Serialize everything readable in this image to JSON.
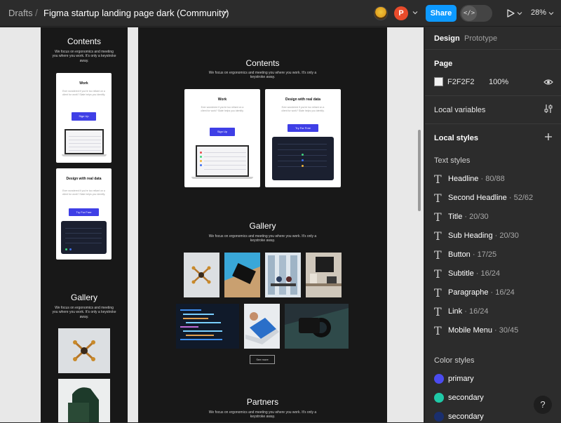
{
  "topbar": {
    "breadcrumb_root": "Drafts",
    "separator": "/",
    "file_title": "Figma startup landing page dark (Community)",
    "avatar_letter": "P",
    "share_label": "Share",
    "dev_mode_glyph": "</>",
    "zoom": "28%"
  },
  "canvas": {
    "small_frame": {
      "contents_title": "Contents",
      "contents_sub": "We focus on ergonomics and meeting you where you work. It's only a keystroke away.",
      "card1": {
        "title": "Work",
        "body": "Ever wondered if you're too reliant on a client for work? Slate helps you identify.",
        "button": "Sign Up"
      },
      "card2": {
        "title": "Design with real data",
        "body": "Ever wondered if you're too reliant on a client for work? Slate helps you identify.",
        "button": "Try For Free"
      },
      "gallery_title": "Gallery",
      "gallery_sub": "We focus on ergonomics and meeting you where you work. It's only a keystroke away."
    },
    "large_frame": {
      "contents_title": "Contents",
      "contents_sub": "We focus on ergonomics and meeting you where you work. It's only a keystroke away.",
      "card1": {
        "title": "Work",
        "body": "Ever wondered if you're too reliant on a client for work? Slate helps you identify.",
        "button": "Sign Up"
      },
      "card2": {
        "title": "Design with real data",
        "body": "Ever wondered if you're too reliant on a client for work? Slate helps you identify.",
        "button": "Try For Free"
      },
      "gallery_title": "Gallery",
      "gallery_sub": "We focus on ergonomics and meeting you where you work. It's only a keystroke away.",
      "see_more": "See more",
      "partners_title": "Partners",
      "partners_sub": "We focus on ergonomics and meeting you where you work. It's only a keystroke away."
    }
  },
  "panel": {
    "tabs": [
      "Design",
      "Prototype"
    ],
    "page": {
      "title": "Page",
      "color_hex": "F2F2F2",
      "opacity": "100%"
    },
    "local_variables": "Local variables",
    "local_styles": "Local styles",
    "text_styles_title": "Text styles",
    "text_styles": [
      {
        "name": "Headline",
        "meta": " · 80/88"
      },
      {
        "name": "Second Headline",
        "meta": " · 52/62"
      },
      {
        "name": "Title",
        "meta": " · 20/30"
      },
      {
        "name": "Sub Heading",
        "meta": " · 20/30"
      },
      {
        "name": "Button",
        "meta": " · 17/25"
      },
      {
        "name": "Subtitle",
        "meta": " · 16/24"
      },
      {
        "name": "Paragraphe",
        "meta": " · 16/24"
      },
      {
        "name": "Link",
        "meta": " · 16/24"
      },
      {
        "name": "Mobile Menu",
        "meta": " · 30/45"
      }
    ],
    "color_styles_title": "Color styles",
    "color_styles": [
      {
        "name": "primary",
        "color": "#4b4bf0"
      },
      {
        "name": "secondary",
        "color": "#1fc9a7"
      },
      {
        "name": "secondary",
        "color": "#1a2f6e"
      }
    ],
    "help": "?"
  },
  "colors": {
    "accent": "#0d99ff",
    "card_button": "#3f3fe6",
    "canvas_bg": "#e8e8e8",
    "frame_bg": "#181818"
  }
}
